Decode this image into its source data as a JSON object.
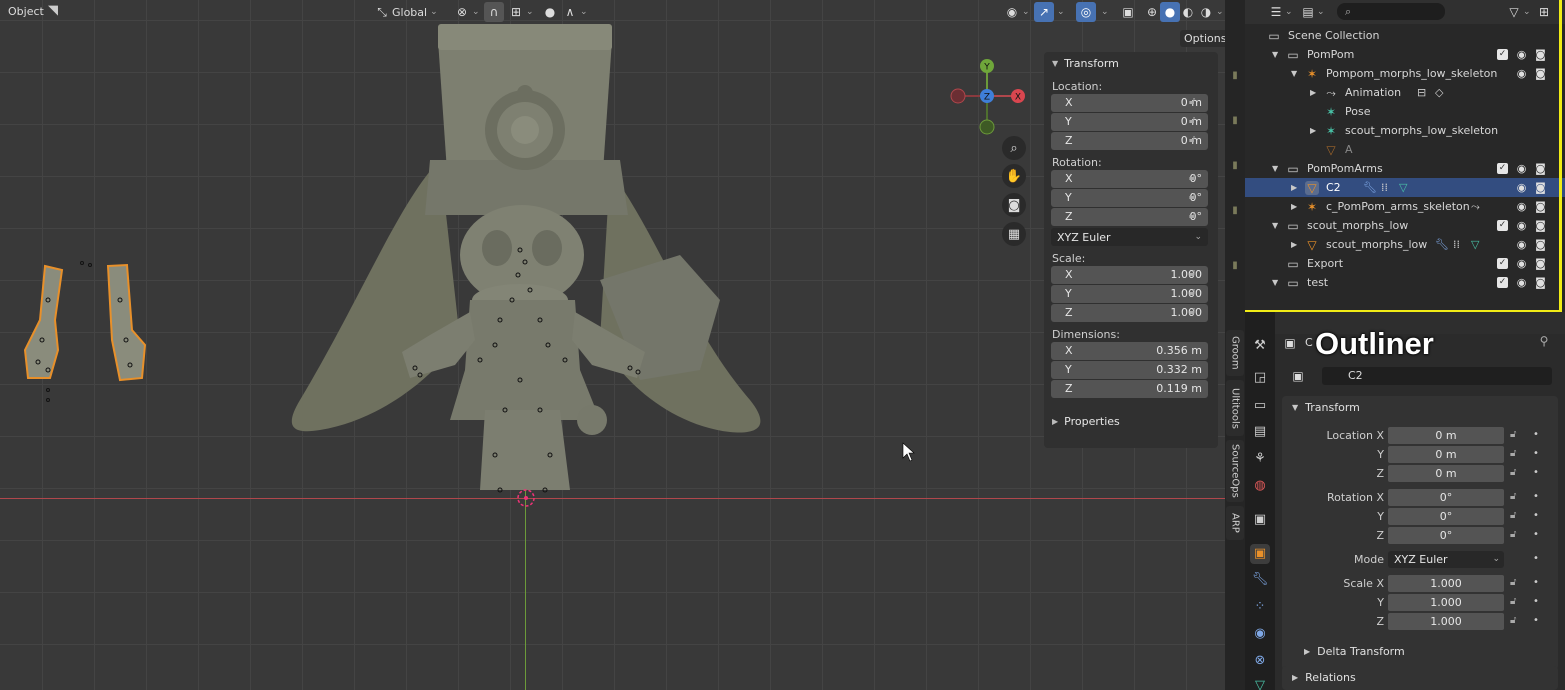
{
  "viewport": {
    "mode_label": "Object",
    "orientation_label": "Global",
    "options_label": "Options",
    "gizmo": {
      "x": "X",
      "y": "Y",
      "z": "Z"
    }
  },
  "npanel": {
    "transform_title": "Transform",
    "location_label": "Location:",
    "location": [
      {
        "axis": "X",
        "value": "0 m"
      },
      {
        "axis": "Y",
        "value": "0 m"
      },
      {
        "axis": "Z",
        "value": "0 m"
      }
    ],
    "rotation_label": "Rotation:",
    "rotation": [
      {
        "axis": "X",
        "value": "0°"
      },
      {
        "axis": "Y",
        "value": "0°"
      },
      {
        "axis": "Z",
        "value": "0°"
      }
    ],
    "rotation_mode": "XYZ Euler",
    "scale_label": "Scale:",
    "scale": [
      {
        "axis": "X",
        "value": "1.000"
      },
      {
        "axis": "Y",
        "value": "1.000"
      },
      {
        "axis": "Z",
        "value": "1.000"
      }
    ],
    "dimensions_label": "Dimensions:",
    "dimensions": [
      {
        "axis": "X",
        "value": "0.356 m"
      },
      {
        "axis": "Y",
        "value": "0.332 m"
      },
      {
        "axis": "Z",
        "value": "0.119 m"
      }
    ],
    "properties_title": "Properties"
  },
  "side_tabs": [
    "Groom",
    "Ultitools",
    "SourceOps",
    "ARP"
  ],
  "outliner": {
    "title_overlay": "Outliner",
    "rows": [
      {
        "label": "Scene Collection"
      },
      {
        "label": "PomPom"
      },
      {
        "label": "Pompom_morphs_low_skeleton"
      },
      {
        "label": "Animation"
      },
      {
        "label": "Pose"
      },
      {
        "label": "scout_morphs_low_skeleton"
      },
      {
        "label": "A"
      },
      {
        "label": "PomPomArms"
      },
      {
        "label": "C2"
      },
      {
        "label": "c_PomPom_arms_skeleton"
      },
      {
        "label": "scout_morphs_low"
      },
      {
        "label": "scout_morphs_low"
      },
      {
        "label": "Export"
      },
      {
        "label": "test"
      }
    ]
  },
  "properties": {
    "object_name_header": "C",
    "object_name": "C2",
    "transform_title": "Transform",
    "location": [
      {
        "label": "Location X",
        "value": "0 m"
      },
      {
        "label": "Y",
        "value": "0 m"
      },
      {
        "label": "Z",
        "value": "0 m"
      }
    ],
    "rotation": [
      {
        "label": "Rotation X",
        "value": "0°"
      },
      {
        "label": "Y",
        "value": "0°"
      },
      {
        "label": "Z",
        "value": "0°"
      }
    ],
    "mode_label": "Mode",
    "mode_value": "XYZ Euler",
    "scale": [
      {
        "label": "Scale X",
        "value": "1.000"
      },
      {
        "label": "Y",
        "value": "1.000"
      },
      {
        "label": "Z",
        "value": "1.000"
      }
    ],
    "delta_title": "Delta Transform",
    "relations_title": "Relations"
  },
  "colors": {
    "highlight": "#f1ec16",
    "selection": "#334d80",
    "accent": "#4772b3",
    "outline": "#e8902a"
  }
}
